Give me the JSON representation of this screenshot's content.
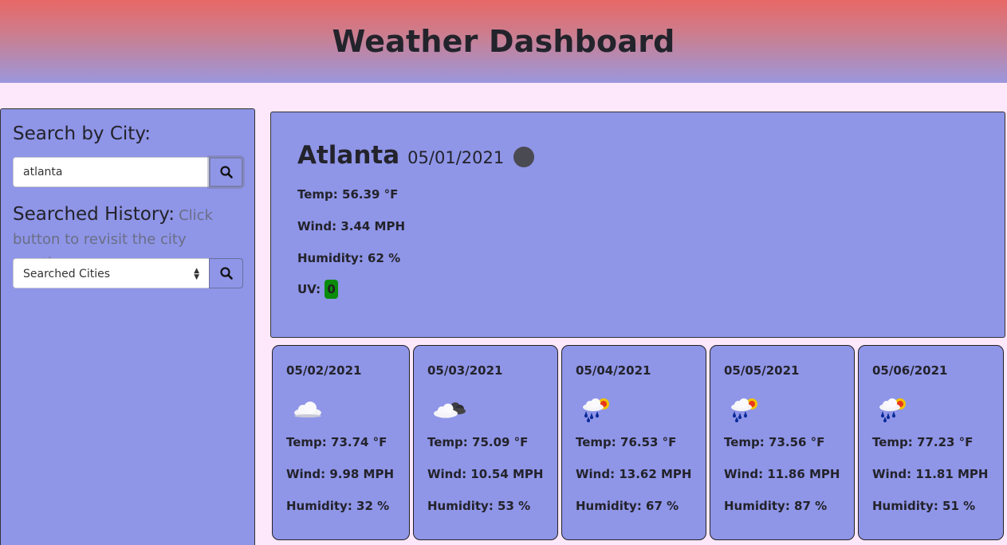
{
  "header": {
    "title": "Weather Dashboard"
  },
  "sidebar": {
    "search_heading": "Search by City:",
    "search_value": "atlanta",
    "history_heading": "Searched History:",
    "history_hint": "Click button to revisit the city weather",
    "history_select_value": "Searched Cities"
  },
  "current": {
    "city": "Atlanta",
    "date": "05/01/2021",
    "icon": "dark-circle-icon",
    "temp": "Temp: 56.39 °F",
    "wind": "Wind: 3.44 MPH",
    "humidity": "Humidity: 62 %",
    "uv_label": "UV:",
    "uv_value": "0",
    "uv_color": "#0a8c0a"
  },
  "forecast": [
    {
      "date": "05/02/2021",
      "icon": "cloud-icon",
      "temp": "Temp: 73.74 °F",
      "wind": "Wind: 9.98 MPH",
      "humidity": "Humidity: 32 %"
    },
    {
      "date": "05/03/2021",
      "icon": "partly-cloudy-night-icon",
      "temp": "Temp: 75.09 °F",
      "wind": "Wind: 10.54 MPH",
      "humidity": "Humidity: 53 %"
    },
    {
      "date": "05/04/2021",
      "icon": "rain-sun-icon",
      "temp": "Temp: 76.53 °F",
      "wind": "Wind: 13.62 MPH",
      "humidity": "Humidity: 67 %"
    },
    {
      "date": "05/05/2021",
      "icon": "rain-sun-icon",
      "temp": "Temp: 73.56 °F",
      "wind": "Wind: 11.86 MPH",
      "humidity": "Humidity: 87 %"
    },
    {
      "date": "05/06/2021",
      "icon": "rain-sun-icon",
      "temp": "Temp: 77.23 °F",
      "wind": "Wind: 11.81 MPH",
      "humidity": "Humidity: 51 %"
    }
  ],
  "colors": {
    "page_bg": "#fde8fb",
    "panel_bg": "#8f95e7",
    "header_top": "#e86866",
    "header_bottom": "#9b97dd"
  }
}
